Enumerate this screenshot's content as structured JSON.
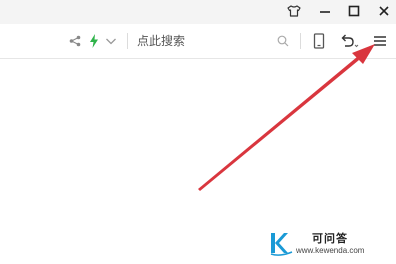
{
  "titlebar": {
    "icons": [
      "skin-icon",
      "minimize-icon",
      "maximize-icon",
      "close-icon"
    ]
  },
  "toolbar": {
    "search_placeholder": "点此搜索",
    "icons": [
      "share-icon",
      "lightning-icon",
      "chevron-down-icon",
      "search-icon",
      "tablet-icon",
      "undo-icon",
      "menu-icon"
    ]
  },
  "annotation": {
    "arrow_color": "#d9363e"
  },
  "watermark": {
    "title": "可问答",
    "url": "www.kewenda.com",
    "accent_color": "#1a9ad6"
  }
}
